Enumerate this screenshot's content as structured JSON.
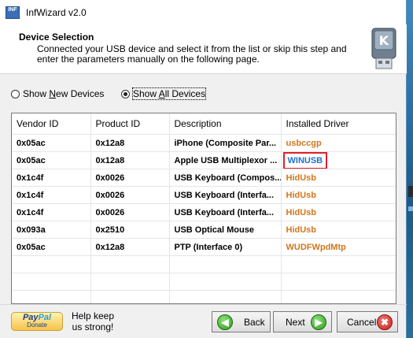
{
  "window": {
    "title": "InfWizard v2.0",
    "app_icon_text": "INF"
  },
  "header": {
    "title": "Device Selection",
    "description": "Connected your USB device and select it from the list or skip this step and enter the parameters manually on the following page."
  },
  "radios": [
    {
      "label": "Show New Devices",
      "selected": false
    },
    {
      "label": "Show All Devices",
      "selected": true
    }
  ],
  "table": {
    "columns": [
      "Vendor ID",
      "Product ID",
      "Description",
      "Installed Driver"
    ],
    "rows": [
      {
        "vendor": "0x05ac",
        "product": "0x12a8",
        "description": "iPhone (Composite Par...",
        "driver": "usbccgp"
      },
      {
        "vendor": "0x05ac",
        "product": "0x12a8",
        "description": "Apple USB Multiplexor ...",
        "driver": "WINUSB"
      },
      {
        "vendor": "0x1c4f",
        "product": "0x0026",
        "description": "USB Keyboard (Compos...",
        "driver": "HidUsb"
      },
      {
        "vendor": "0x1c4f",
        "product": "0x0026",
        "description": "USB Keyboard (Interfa...",
        "driver": "HidUsb"
      },
      {
        "vendor": "0x1c4f",
        "product": "0x0026",
        "description": "USB Keyboard (Interfa...",
        "driver": "HidUsb"
      },
      {
        "vendor": "0x093a",
        "product": "0x2510",
        "description": "USB Optical Mouse",
        "driver": "HidUsb"
      },
      {
        "vendor": "0x05ac",
        "product": "0x12a8",
        "description": "PTP (Interface 0)",
        "driver": "WUDFWpdMtp"
      }
    ],
    "highlighted_row_index": 1
  },
  "footer": {
    "paypal_logo": "PayPal",
    "paypal_sub": "Donate",
    "help_text": "Help keep us strong!",
    "back_label": "Back",
    "next_label": "Next",
    "cancel_label": "Cancel"
  },
  "colors": {
    "driver_text": "#d3761a",
    "highlight_driver": "#1f6fd1",
    "highlight_border": "#e0202a"
  }
}
